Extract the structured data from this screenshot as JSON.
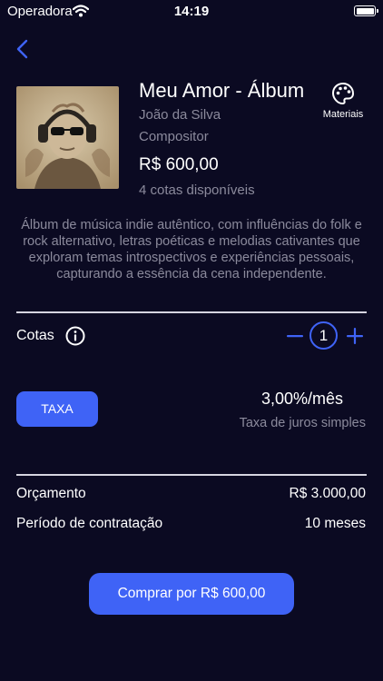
{
  "status_bar": {
    "carrier": "Operadora",
    "time": "14:19"
  },
  "product": {
    "title": "Meu Amor - Álbum",
    "artist": "João da Silva",
    "role": "Compositor",
    "price": "R$ 600,00",
    "quotas_available": "4 cotas disponíveis",
    "materials_label": "Materiais"
  },
  "description": "Álbum de música indie autêntico, com influências do folk e rock alternativo, letras poéticas e melodias cativantes que exploram temas introspectivos e experiências pessoais, capturando a essência da cena independente.",
  "cotas": {
    "label": "Cotas",
    "value": "1"
  },
  "taxa": {
    "button_label": "TAXA",
    "rate": "3,00%/mês",
    "rate_description": "Taxa de juros simples"
  },
  "summary": {
    "budget_label": "Orçamento",
    "budget_value": "R$ 3.000,00",
    "period_label": "Período de contratação",
    "period_value": "10 meses"
  },
  "buy_button_label": "Comprar por R$ 600,00",
  "colors": {
    "background": "#0b0a22",
    "accent": "#3f63f6",
    "muted_text": "#8b8a9c"
  }
}
